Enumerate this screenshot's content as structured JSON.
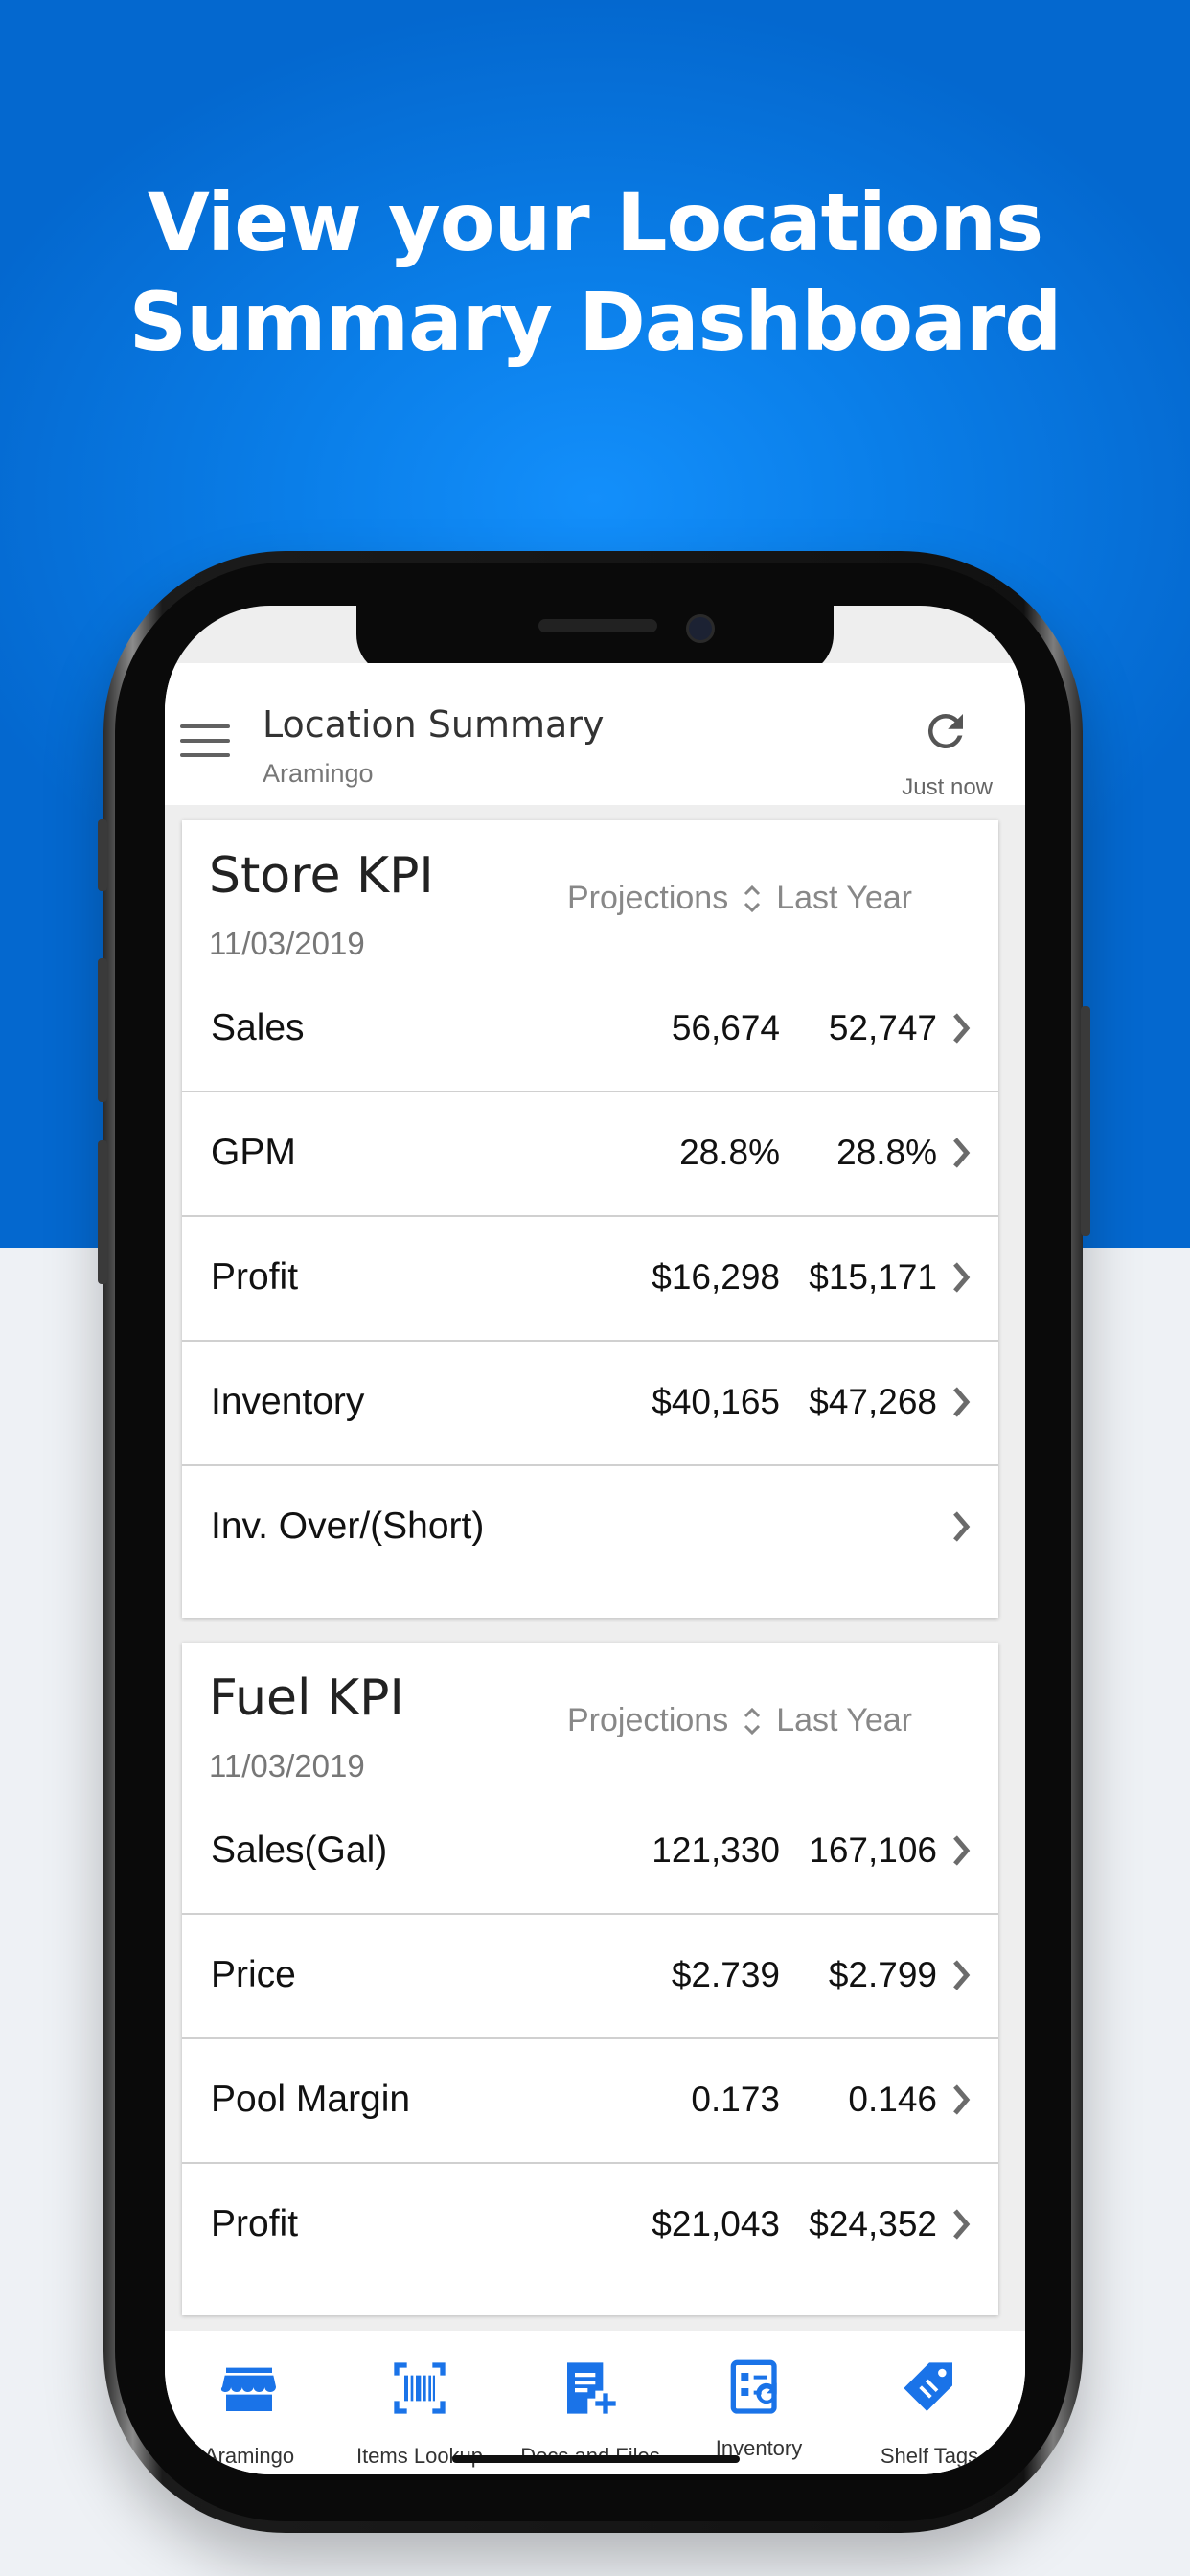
{
  "headline": {
    "line1": "View your Locations",
    "line2": "Summary Dashboard"
  },
  "appbar": {
    "title": "Location Summary",
    "subtitle": "Aramingo",
    "refresh_label": "Just now"
  },
  "colors": {
    "brand_blue": "#0a7ee8",
    "tab_blue": "#1a73e8",
    "background": "#eef1f5"
  },
  "store_kpi": {
    "title": "Store KPI",
    "date": "11/03/2019",
    "col1": "Projections",
    "col2": "Last Year",
    "rows": [
      {
        "label": "Sales",
        "projection": "56,674",
        "last_year": "52,747"
      },
      {
        "label": "GPM",
        "projection": "28.8%",
        "last_year": "28.8%"
      },
      {
        "label": "Profit",
        "projection": "$16,298",
        "last_year": "$15,171"
      },
      {
        "label": "Inventory",
        "projection": "$40,165",
        "last_year": "$47,268"
      },
      {
        "label": "Inv. Over/(Short)",
        "projection": "",
        "last_year": ""
      }
    ]
  },
  "fuel_kpi": {
    "title": "Fuel KPI",
    "date": "11/03/2019",
    "col1": "Projections",
    "col2": "Last Year",
    "rows": [
      {
        "label": "Sales(Gal)",
        "projection": "121,330",
        "last_year": "167,106"
      },
      {
        "label": "Price",
        "projection": "$2.739",
        "last_year": "$2.799"
      },
      {
        "label": "Pool Margin",
        "projection": "0.173",
        "last_year": "0.146"
      },
      {
        "label": "Profit",
        "projection": "$21,043",
        "last_year": "$24,352"
      }
    ]
  },
  "tabs": [
    {
      "label": "Aramingo",
      "icon": "store-icon"
    },
    {
      "label": "Items Lookup",
      "icon": "barcode-icon"
    },
    {
      "label": "Docs and Files",
      "icon": "add-document-icon"
    },
    {
      "label": "Inventory",
      "icon": "inventory-icon"
    },
    {
      "label": "Shelf Tags",
      "icon": "tag-icon"
    }
  ]
}
